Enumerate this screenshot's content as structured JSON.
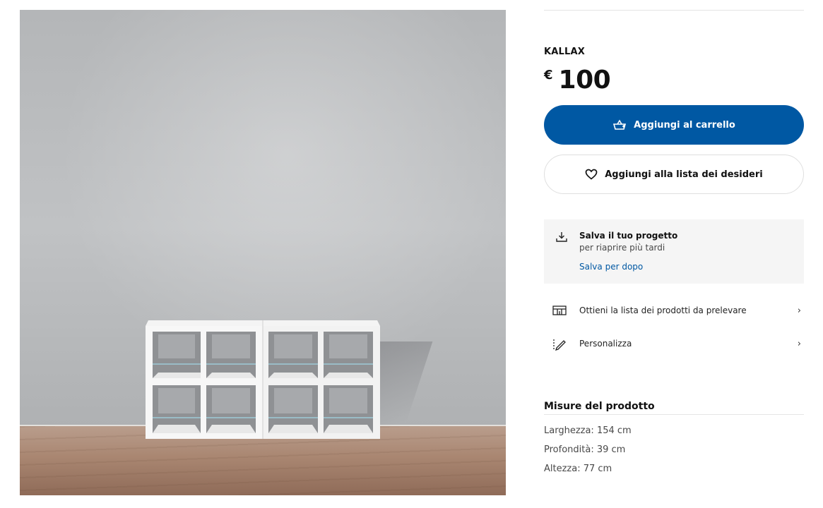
{
  "product": {
    "name": "KALLAX",
    "currency": "€",
    "price": "100"
  },
  "actions": {
    "add_to_cart": "Aggiungi al carrello",
    "add_to_wishlist": "Aggiungi alla lista dei desideri"
  },
  "save_project": {
    "title": "Salva il tuo progetto",
    "subtitle": "per riaprire più tardi",
    "link": "Salva per dopo"
  },
  "options": [
    {
      "label": "Ottieni la lista dei prodotti da prelevare",
      "icon": "list-icon"
    },
    {
      "label": "Personalizza",
      "icon": "pencil-icon"
    }
  ],
  "measures": {
    "title": "Misure del prodotto",
    "width": "Larghezza: 154 cm",
    "depth": "Profondità: 39 cm",
    "height": "Altezza: 77 cm"
  },
  "colors": {
    "accent": "#0058a3",
    "panel_bg": "#f5f5f5"
  }
}
